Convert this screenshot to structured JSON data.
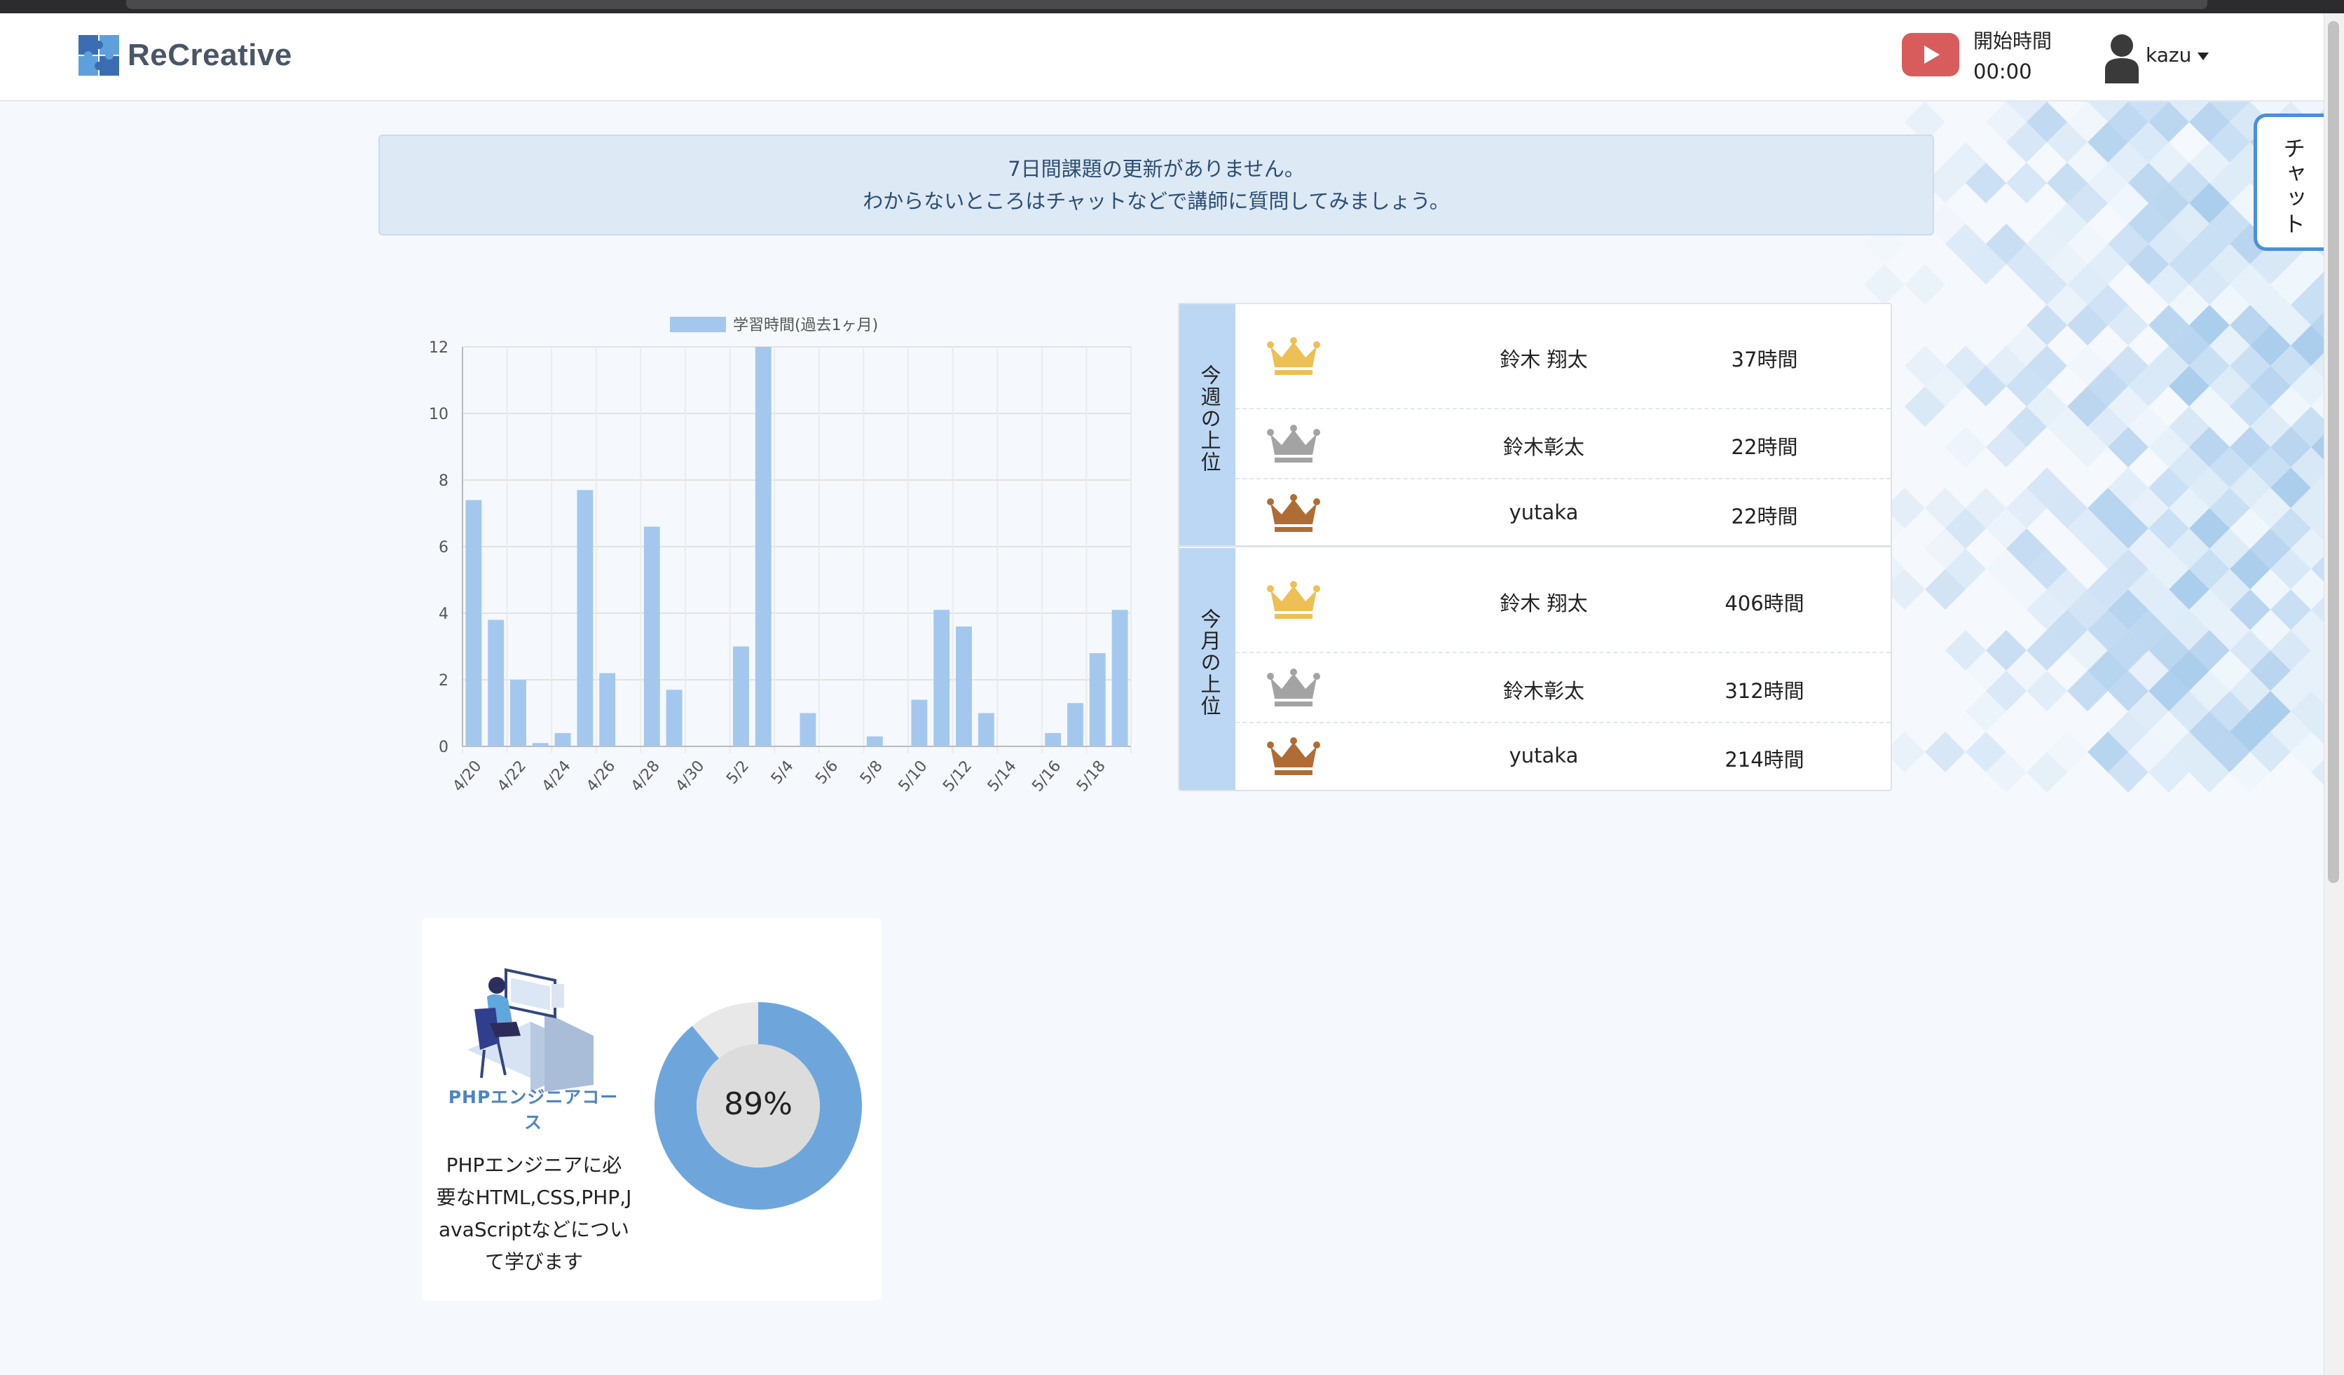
{
  "header": {
    "logo_text": "ReCreative",
    "start_label": "開始時間",
    "start_time": "00:00",
    "user_name": "kazu"
  },
  "chat_tab": {
    "label": "チャット"
  },
  "notice": {
    "line1": "7日間課題の更新がありません。",
    "line2": "わからないところはチャットなどで講師に質問してみましょう。"
  },
  "chart_data": {
    "type": "bar",
    "title": "",
    "xlabel": "",
    "ylabel": "",
    "series": [
      {
        "name": "学習時間(過去1ヶ月)",
        "color": "#a4c8ed",
        "values": [
          7.4,
          3.8,
          2.0,
          0.1,
          0.4,
          7.7,
          2.2,
          0,
          6.6,
          1.7,
          0,
          0,
          3.0,
          12.0,
          0,
          1.0,
          0,
          0,
          0.3,
          0,
          1.4,
          4.1,
          3.6,
          1.0,
          0,
          0,
          0.4,
          1.3,
          2.8,
          4.1
        ]
      }
    ],
    "categories": [
      "4/20",
      "4/21",
      "4/22",
      "4/23",
      "4/24",
      "4/25",
      "4/26",
      "4/27",
      "4/28",
      "4/29",
      "4/30",
      "5/1",
      "5/2",
      "5/3",
      "5/4",
      "5/5",
      "5/6",
      "5/7",
      "5/8",
      "5/9",
      "5/10",
      "5/11",
      "5/12",
      "5/13",
      "5/14",
      "5/15",
      "5/16",
      "5/17",
      "5/18",
      "5/19"
    ],
    "tick_labels": [
      "4/20",
      "4/22",
      "4/24",
      "4/26",
      "4/28",
      "4/30",
      "5/2",
      "5/4",
      "5/6",
      "5/8",
      "5/10",
      "5/12",
      "5/14",
      "5/16",
      "5/18"
    ],
    "y_ticks": [
      "0",
      "2",
      "4",
      "6",
      "8",
      "10",
      "12"
    ],
    "ylim": [
      0,
      12
    ],
    "grid": true,
    "legend": "top"
  },
  "ranking": {
    "weekly": {
      "title": "今週の上位",
      "rows": [
        {
          "name": "鈴木 翔太",
          "hours": "37時間",
          "crown": "gold-crown-icon"
        },
        {
          "name": "鈴木彰太",
          "hours": "22時間",
          "crown": "silver-crown-icon"
        },
        {
          "name": "yutaka",
          "hours": "22時間",
          "crown": "bronze-crown-icon"
        }
      ]
    },
    "monthly": {
      "title": "今月の上位",
      "rows": [
        {
          "name": "鈴木 翔太",
          "hours": "406時間",
          "crown": "gold-crown-icon"
        },
        {
          "name": "鈴木彰太",
          "hours": "312時間",
          "crown": "silver-crown-icon"
        },
        {
          "name": "yutaka",
          "hours": "214時間",
          "crown": "bronze-crown-icon"
        }
      ]
    },
    "colors": {
      "gold": "#ecc054",
      "silver": "#a3a3a3",
      "bronze": "#b06c35"
    }
  },
  "course": {
    "title": "PHPエンジニアコース",
    "description_lines": [
      "PHPエンジニアに必",
      "要なHTML,CSS,PHP,J",
      "avaScriptなどについ",
      "て学びます"
    ],
    "progress_label": "89%",
    "progress": 0.89,
    "progress_color": "#6ea6dc"
  }
}
